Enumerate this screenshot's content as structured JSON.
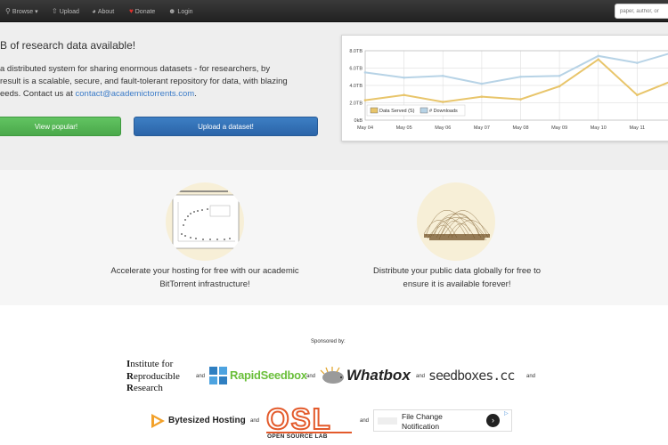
{
  "nav": {
    "browse": "Browse",
    "upload": "Upload",
    "about": "About",
    "donate": "Donate",
    "login": "Login",
    "search_placeholder": "paper, author, or"
  },
  "hero": {
    "headline": "B of research data available!",
    "line1": "a distributed system for sharing enormous datasets - for researchers, by",
    "line2": "result is a scalable, secure, and fault-tolerant repository for data, with blazing",
    "line3_pre": "eeds. Contact us at ",
    "email": "contact@academictorrents.com",
    "line3_post": ".",
    "btn_popular": "View popular!",
    "btn_upload": "Upload a dataset!"
  },
  "chart_data": {
    "type": "line",
    "categories": [
      "May 04",
      "May 05",
      "May 06",
      "May 07",
      "May 08",
      "May 09",
      "May 10",
      "May 11",
      "Ma"
    ],
    "y_ticks": [
      "8.0TB",
      "6.0TB",
      "4.0TB",
      "2.0TB",
      "0kB"
    ],
    "ylim": [
      0,
      8
    ],
    "grid": true,
    "legend_position": "bottom-left",
    "series": [
      {
        "name": "Data Served (S)",
        "color": "#e8c56b",
        "values": [
          2.3,
          2.9,
          2.1,
          2.7,
          2.4,
          3.9,
          7.0,
          2.9,
          4.7
        ]
      },
      {
        "name": "# Downloads",
        "color": "#b7d3e6",
        "values": [
          5.5,
          4.9,
          5.1,
          4.2,
          5.0,
          5.1,
          7.4,
          6.6,
          7.9
        ]
      }
    ]
  },
  "features": {
    "left_line1": "Accelerate your hosting for free with our academic",
    "left_line2": "BitTorrent infrastructure!",
    "right_line1": "Distribute your public data globally for free to",
    "right_line2": "ensure it is available forever!"
  },
  "sponsors": {
    "title": "Sponsored by:",
    "irr_l1_cap": "I",
    "irr_l1": "nstitute for",
    "irr_l2_cap": "R",
    "irr_l2": "eproducible",
    "irr_l3_cap": "R",
    "irr_l3": "esearch",
    "and": "and",
    "rapidseedbox": "RapidSeedbox",
    "whatbox": "Whatbox",
    "seedboxes": "seedboxes.cc",
    "bytesized": "Bytesized Hosting",
    "osl": "OSL",
    "osl_sub": "OPEN SOURCE LAB",
    "ad_line1": "File Change",
    "ad_line2": "Notification"
  }
}
